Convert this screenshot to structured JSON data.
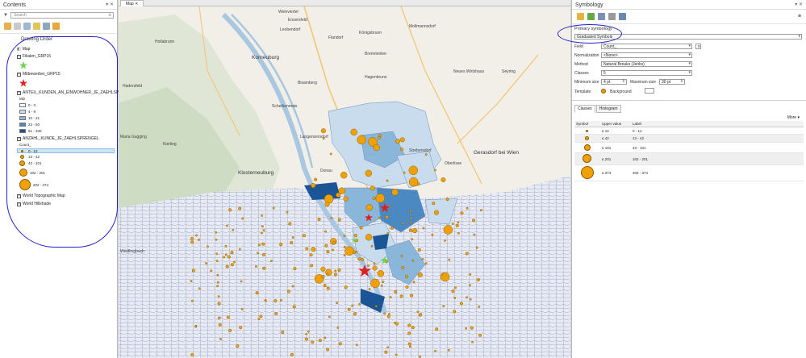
{
  "contents": {
    "title": "Contents",
    "search_placeholder": "Search",
    "drawing_order": "Drawing Order",
    "map_label": "Map",
    "layers": {
      "filialen": "Filialen_GRP15",
      "mitbewerber": "Mitbewerber_GRP15",
      "anteil": "ANTEIL_KUNDEN_AN_EINWOHNER_JE_ZAEHLSPRENGEL",
      "anteil_field": "MD",
      "anzahl": "ANZAHL_KUNDE_JE_ZAEHLSPRENGEL",
      "anzahl_field": "Count_",
      "topo": "World Topographic Map",
      "hillshade": "World Hillshade"
    },
    "anteil_classes": [
      {
        "label": "0 - 3",
        "color": "#f7f7fb"
      },
      {
        "label": "4 - 9",
        "color": "#c9dcee"
      },
      {
        "label": "10 - 21",
        "color": "#8ab6da"
      },
      {
        "label": "22 - 50",
        "color": "#4a89c1"
      },
      {
        "label": "51 - 100",
        "color": "#1c5596"
      }
    ],
    "anzahl_classes": [
      "0 - 12",
      "13 - 42",
      "43 - 101",
      "102 - 201",
      "202 - 374"
    ]
  },
  "map": {
    "tab": "Map",
    "places": [
      "Weinviertel",
      "Leobendorf",
      "Flandorf",
      "Bisamberg",
      "Korneuburg",
      "Hagenbrunn",
      "Königsbrunn",
      "Enzersfeld",
      "Mollmannsdorf",
      "Brenntenlee",
      "Hollabrunn",
      "Seyring",
      "Neues Wirtshaus",
      "Scheibenmais",
      "Klosterneuburg",
      "Langenzersdorf",
      "Strebersdorf",
      "Gerasdorf bei Wien",
      "Oberlisse",
      "Kierling",
      "Maria Gugging",
      "Weidlingbach",
      "Hadersfeld",
      "Donau"
    ]
  },
  "symbology": {
    "title": "Symbology",
    "primary_label": "Primary symbology",
    "primary_value": "Graduated Symbols",
    "field_label": "Field",
    "field_value": "Count_",
    "normalization_label": "Normalization",
    "normalization_value": "<None>",
    "method_label": "Method",
    "method_value": "Natural Breaks (Jenks)",
    "classes_label": "Classes",
    "classes_value": "5",
    "min_label": "Minimum size",
    "min_value": "4 pt",
    "max_label": "Maximum size",
    "max_value": "30 pt",
    "template_label": "Template",
    "background_label": "Background",
    "tab_classes": "Classes",
    "tab_histogram": "Histogram",
    "more": "More",
    "col_symbol": "Symbol",
    "col_upper": "Upper value",
    "col_label": "Label",
    "rows": [
      {
        "upper": "≤  12",
        "label": "0 - 12"
      },
      {
        "upper": "≤  42",
        "label": "13 - 42"
      },
      {
        "upper": "≤  101",
        "label": "43 - 101"
      },
      {
        "upper": "≤  201",
        "label": "102 - 201"
      },
      {
        "upper": "≤  374",
        "label": "202 - 374"
      }
    ]
  }
}
